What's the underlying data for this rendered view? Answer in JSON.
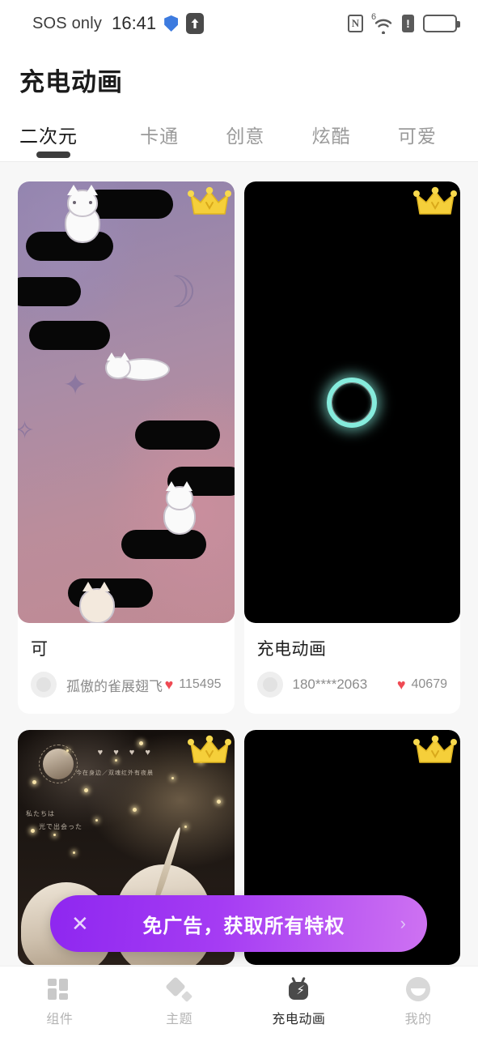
{
  "status_bar": {
    "carrier": "SOS only",
    "time": "16:41",
    "shield_icon": "shield-icon",
    "upload_icon": "upload-arrow-icon",
    "nfc_icon": "N",
    "wifi_generation": "6",
    "alert_icon": "!",
    "battery_icon": "battery-icon"
  },
  "header": {
    "title": "充电动画",
    "tabs": [
      {
        "label": "二次元",
        "active": true
      },
      {
        "label": "卡通",
        "active": false
      },
      {
        "label": "创意",
        "active": false
      },
      {
        "label": "炫酷",
        "active": false
      },
      {
        "label": "可爱",
        "active": false
      }
    ]
  },
  "cards": [
    {
      "title": "可",
      "author": "孤傲的雀展翅飞",
      "likes": "115495",
      "badge": "crown-badge",
      "thumb_style": "cats-on-platforms"
    },
    {
      "title": "充电动画",
      "author": "180****2063",
      "likes": "40679",
      "badge": "crown-badge",
      "thumb_style": "black-cyan-ring"
    },
    {
      "title": "",
      "author": "",
      "likes": "",
      "badge": "crown-badge",
      "thumb_style": "anime-starry",
      "overlay_text_1": "今在身边／双魂红外有夜晨",
      "overlay_text_2": "私たちは",
      "overlay_text_3": "光で出会った",
      "hearts": "♥ ♥ ♥ ♥"
    },
    {
      "title": "",
      "author": "",
      "likes": "",
      "badge": "crown-badge",
      "thumb_style": "black-plain"
    }
  ],
  "promo": {
    "close_label": "✕",
    "text": "免广告，获取所有特权",
    "chevron": "›",
    "gradient_start": "#8e27f0",
    "gradient_end": "#ce72f2"
  },
  "bottom_nav": [
    {
      "label": "组件",
      "icon": "widget-icon",
      "active": false
    },
    {
      "label": "主题",
      "icon": "theme-icon",
      "active": false
    },
    {
      "label": "充电动画",
      "icon": "charging-animation-icon",
      "active": true
    },
    {
      "label": "我的",
      "icon": "profile-icon",
      "active": false
    }
  ],
  "colors": {
    "accent_purple": "#a53cf3",
    "heart_red": "#ef4a53",
    "ring_cyan": "#86ecdd",
    "background": "#f7f7f7"
  }
}
